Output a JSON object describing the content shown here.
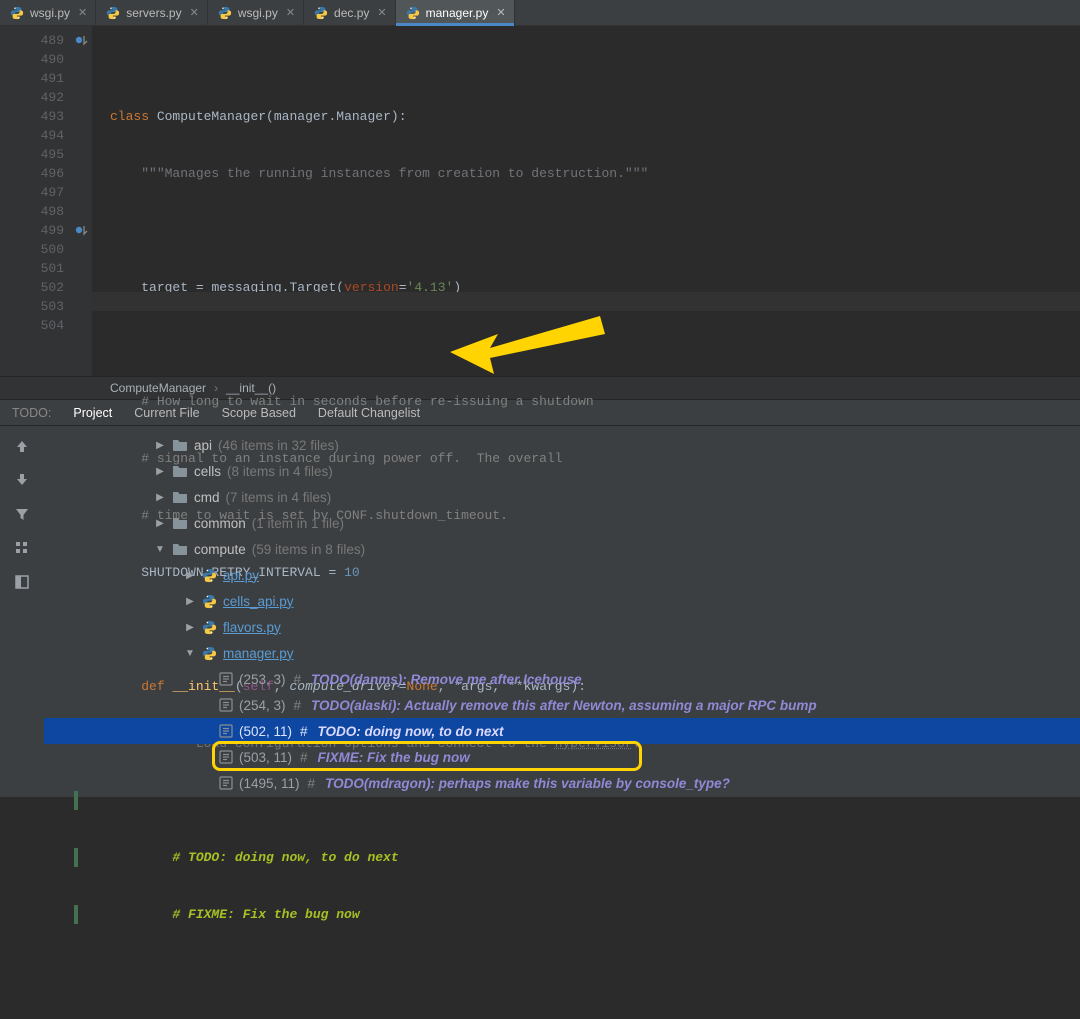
{
  "tabs": [
    {
      "label": "wsgi.py",
      "active": false
    },
    {
      "label": "servers.py",
      "active": false
    },
    {
      "label": "wsgi.py",
      "active": false
    },
    {
      "label": "dec.py",
      "active": false
    },
    {
      "label": "manager.py",
      "active": true
    }
  ],
  "gutter_start": 489,
  "code": {
    "l489": {
      "kw": "class",
      "name": "ComputeManager",
      "base": "manager.Manager"
    },
    "l490": {
      "doc": "\"\"\"Manages the running instances from creation to destruction.\"\"\""
    },
    "l492": {
      "lhs": "target",
      "mod": "messaging",
      "call": "Target",
      "kwarg": "version",
      "val": "'4.13'"
    },
    "l494": "# How long to wait in seconds before re-issuing a shutdown",
    "l495": "# signal to an instance during power off.  The overall",
    "l496": "# time to wait is set by CONF.shutdown_timeout.",
    "l497": {
      "lhs": "SHUTDOWN_RETRY_INTERVAL",
      "val": "10"
    },
    "l499": {
      "kw": "def",
      "name": "__init__",
      "params": [
        "self",
        "compute_driver"
      ],
      "default": "None",
      "rest": "*args",
      "kwrest": "**kwargs"
    },
    "l500": {
      "doc_pre": "\"\"\"Load configuration options and connect to the ",
      "doc_link": "hypervisor",
      "doc_post": ".\"\"\""
    },
    "l502": "# TODO: doing now, to do next",
    "l503": "# FIXME: Fix the bug now"
  },
  "breadcrumb": {
    "a": "ComputeManager",
    "b": "__init__()"
  },
  "todoBar": {
    "label": "TODO:",
    "scopes": [
      "Project",
      "Current File",
      "Scope Based",
      "Default Changelist"
    ],
    "active": 0
  },
  "tree": {
    "folders": [
      {
        "name": "api",
        "hint": "(46 items in 32 files)",
        "indent": 110,
        "expanded": false
      },
      {
        "name": "cells",
        "hint": "(8 items in 4 files)",
        "indent": 110,
        "expanded": false
      },
      {
        "name": "cmd",
        "hint": "(7 items in 4 files)",
        "indent": 110,
        "expanded": false
      },
      {
        "name": "common",
        "hint": "(1 item in 1 file)",
        "indent": 110,
        "expanded": false
      },
      {
        "name": "compute",
        "hint": "(59 items in 8 files)",
        "indent": 110,
        "expanded": true
      }
    ],
    "files": [
      {
        "name": "api.py",
        "indent": 140,
        "expanded": false
      },
      {
        "name": "cells_api.py",
        "indent": 140,
        "expanded": false
      },
      {
        "name": "flavors.py",
        "indent": 140,
        "expanded": false
      },
      {
        "name": "manager.py",
        "indent": 140,
        "expanded": true
      }
    ],
    "items": [
      {
        "loc": "(253, 3)",
        "text": "TODO(danms): Remove me after Icehouse",
        "indent": 175,
        "selected": false
      },
      {
        "loc": "(254, 3)",
        "text": "TODO(alaski): Actually remove this after Newton, assuming a major RPC bump",
        "indent": 175,
        "selected": false
      },
      {
        "loc": "(502, 11)",
        "text": "TODO: doing now, to do next",
        "indent": 175,
        "selected": true
      },
      {
        "loc": "(503, 11)",
        "text": "FIXME: Fix the bug now",
        "indent": 175,
        "selected": false,
        "boxed": true
      },
      {
        "loc": "(1495, 11)",
        "text": "TODO(mdragon): perhaps make this variable by console_type?",
        "indent": 175,
        "selected": false
      }
    ]
  }
}
